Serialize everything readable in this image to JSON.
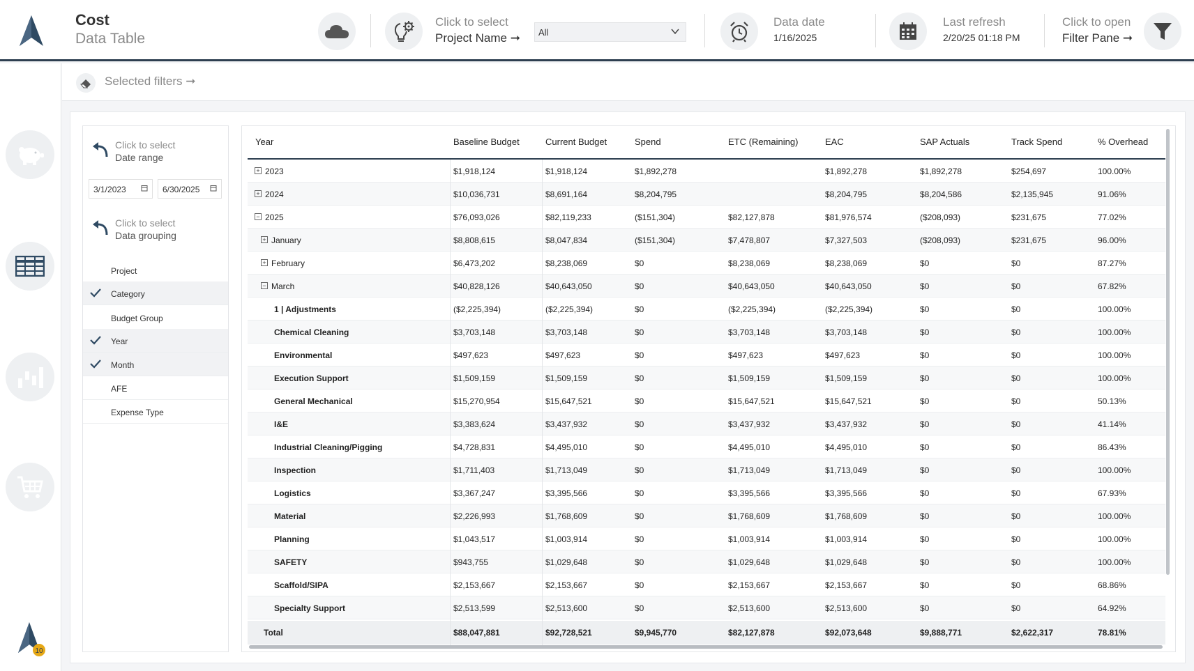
{
  "header": {
    "title": "Cost",
    "subtitle": "Data Table",
    "project": {
      "click_label": "Click to select",
      "label": "Project Name ➞",
      "selected": "All"
    },
    "data_date": {
      "label": "Data date",
      "value": "1/16/2025"
    },
    "last_refresh": {
      "label": "Last refresh",
      "value": "2/20/25 01:18 PM"
    },
    "filter_pane": {
      "click_label": "Click to open",
      "label": "Filter Pane ➞"
    },
    "logo_badge": "10"
  },
  "filterbar": {
    "label": "Selected filters ➞"
  },
  "side_panel": {
    "date_range": {
      "click_label": "Click to select",
      "label": "Date range",
      "start": "3/1/2023",
      "end": "6/30/2025"
    },
    "data_grouping": {
      "click_label": "Click to select",
      "label": "Data grouping"
    },
    "groups": [
      {
        "label": "Project",
        "checked": false
      },
      {
        "label": "Category",
        "checked": true
      },
      {
        "label": "Budget Group",
        "checked": false
      },
      {
        "label": "Year",
        "checked": true
      },
      {
        "label": "Month",
        "checked": true
      },
      {
        "label": "AFE",
        "checked": false
      },
      {
        "label": "Expense Type",
        "checked": false
      }
    ]
  },
  "table": {
    "columns": [
      "Year",
      "Baseline Budget",
      "Current Budget",
      "Spend",
      "ETC (Remaining)",
      "EAC",
      "SAP Actuals",
      "Track Spend",
      "% Overhead"
    ],
    "rows": [
      {
        "label": "2023",
        "level": 0,
        "toggle": "+",
        "values": [
          "$1,918,124",
          "$1,918,124",
          "$1,892,278",
          "",
          "$1,892,278",
          "$1,892,278",
          "$254,697",
          "100.00%"
        ]
      },
      {
        "label": "2024",
        "level": 0,
        "toggle": "+",
        "values": [
          "$10,036,731",
          "$8,691,164",
          "$8,204,795",
          "",
          "$8,204,795",
          "$8,204,586",
          "$2,135,945",
          "91.06%"
        ]
      },
      {
        "label": "2025",
        "level": 0,
        "toggle": "−",
        "values": [
          "$76,093,026",
          "$82,119,233",
          "($151,304)",
          "$82,127,878",
          "$81,976,574",
          "($208,093)",
          "$231,675",
          "77.02%"
        ]
      },
      {
        "label": "January",
        "level": 1,
        "toggle": "+",
        "values": [
          "$8,808,615",
          "$8,047,834",
          "($151,304)",
          "$7,478,807",
          "$7,327,503",
          "($208,093)",
          "$231,675",
          "96.00%"
        ]
      },
      {
        "label": "February",
        "level": 1,
        "toggle": "+",
        "values": [
          "$6,473,202",
          "$8,238,069",
          "$0",
          "$8,238,069",
          "$8,238,069",
          "$0",
          "$0",
          "87.27%"
        ]
      },
      {
        "label": "March",
        "level": 1,
        "toggle": "−",
        "values": [
          "$40,828,126",
          "$40,643,050",
          "$0",
          "$40,643,050",
          "$40,643,050",
          "$0",
          "$0",
          "67.82%"
        ]
      },
      {
        "label": "1 | Adjustments",
        "level": 2,
        "toggle": "",
        "values": [
          "($2,225,394)",
          "($2,225,394)",
          "$0",
          "($2,225,394)",
          "($2,225,394)",
          "$0",
          "$0",
          "100.00%"
        ]
      },
      {
        "label": "Chemical Cleaning",
        "level": 2,
        "toggle": "",
        "values": [
          "$3,703,148",
          "$3,703,148",
          "$0",
          "$3,703,148",
          "$3,703,148",
          "$0",
          "$0",
          "100.00%"
        ]
      },
      {
        "label": "Environmental",
        "level": 2,
        "toggle": "",
        "values": [
          "$497,623",
          "$497,623",
          "$0",
          "$497,623",
          "$497,623",
          "$0",
          "$0",
          "100.00%"
        ]
      },
      {
        "label": "Execution Support",
        "level": 2,
        "toggle": "",
        "values": [
          "$1,509,159",
          "$1,509,159",
          "$0",
          "$1,509,159",
          "$1,509,159",
          "$0",
          "$0",
          "100.00%"
        ]
      },
      {
        "label": "General Mechanical",
        "level": 2,
        "toggle": "",
        "values": [
          "$15,270,954",
          "$15,647,521",
          "$0",
          "$15,647,521",
          "$15,647,521",
          "$0",
          "$0",
          "50.13%"
        ]
      },
      {
        "label": "I&E",
        "level": 2,
        "toggle": "",
        "values": [
          "$3,383,624",
          "$3,437,932",
          "$0",
          "$3,437,932",
          "$3,437,932",
          "$0",
          "$0",
          "41.14%"
        ]
      },
      {
        "label": "Industrial Cleaning/Pigging",
        "level": 2,
        "toggle": "",
        "values": [
          "$4,728,831",
          "$4,495,010",
          "$0",
          "$4,495,010",
          "$4,495,010",
          "$0",
          "$0",
          "86.43%"
        ]
      },
      {
        "label": "Inspection",
        "level": 2,
        "toggle": "",
        "values": [
          "$1,711,403",
          "$1,713,049",
          "$0",
          "$1,713,049",
          "$1,713,049",
          "$0",
          "$0",
          "100.00%"
        ]
      },
      {
        "label": "Logistics",
        "level": 2,
        "toggle": "",
        "values": [
          "$3,367,247",
          "$3,395,566",
          "$0",
          "$3,395,566",
          "$3,395,566",
          "$0",
          "$0",
          "67.93%"
        ]
      },
      {
        "label": "Material",
        "level": 2,
        "toggle": "",
        "values": [
          "$2,226,993",
          "$1,768,609",
          "$0",
          "$1,768,609",
          "$1,768,609",
          "$0",
          "$0",
          "100.00%"
        ]
      },
      {
        "label": "Planning",
        "level": 2,
        "toggle": "",
        "values": [
          "$1,043,517",
          "$1,003,914",
          "$0",
          "$1,003,914",
          "$1,003,914",
          "$0",
          "$0",
          "100.00%"
        ]
      },
      {
        "label": "SAFETY",
        "level": 2,
        "toggle": "",
        "values": [
          "$943,755",
          "$1,029,648",
          "$0",
          "$1,029,648",
          "$1,029,648",
          "$0",
          "$0",
          "100.00%"
        ]
      },
      {
        "label": "Scaffold/SIPA",
        "level": 2,
        "toggle": "",
        "values": [
          "$2,153,667",
          "$2,153,667",
          "$0",
          "$2,153,667",
          "$2,153,667",
          "$0",
          "$0",
          "68.86%"
        ]
      },
      {
        "label": "Specialty Support",
        "level": 2,
        "toggle": "",
        "values": [
          "$2,513,599",
          "$2,513,600",
          "$0",
          "$2,513,600",
          "$2,513,600",
          "$0",
          "$0",
          "64.92%"
        ]
      }
    ],
    "total": {
      "label": "Total",
      "values": [
        "$88,047,881",
        "$92,728,521",
        "$9,945,770",
        "$82,127,878",
        "$92,073,648",
        "$9,888,771",
        "$2,622,317",
        "78.81%"
      ]
    }
  },
  "colors": {
    "accent": "#2d3e50",
    "icon": "#2f4a63",
    "muted": "#8a8a8a"
  }
}
